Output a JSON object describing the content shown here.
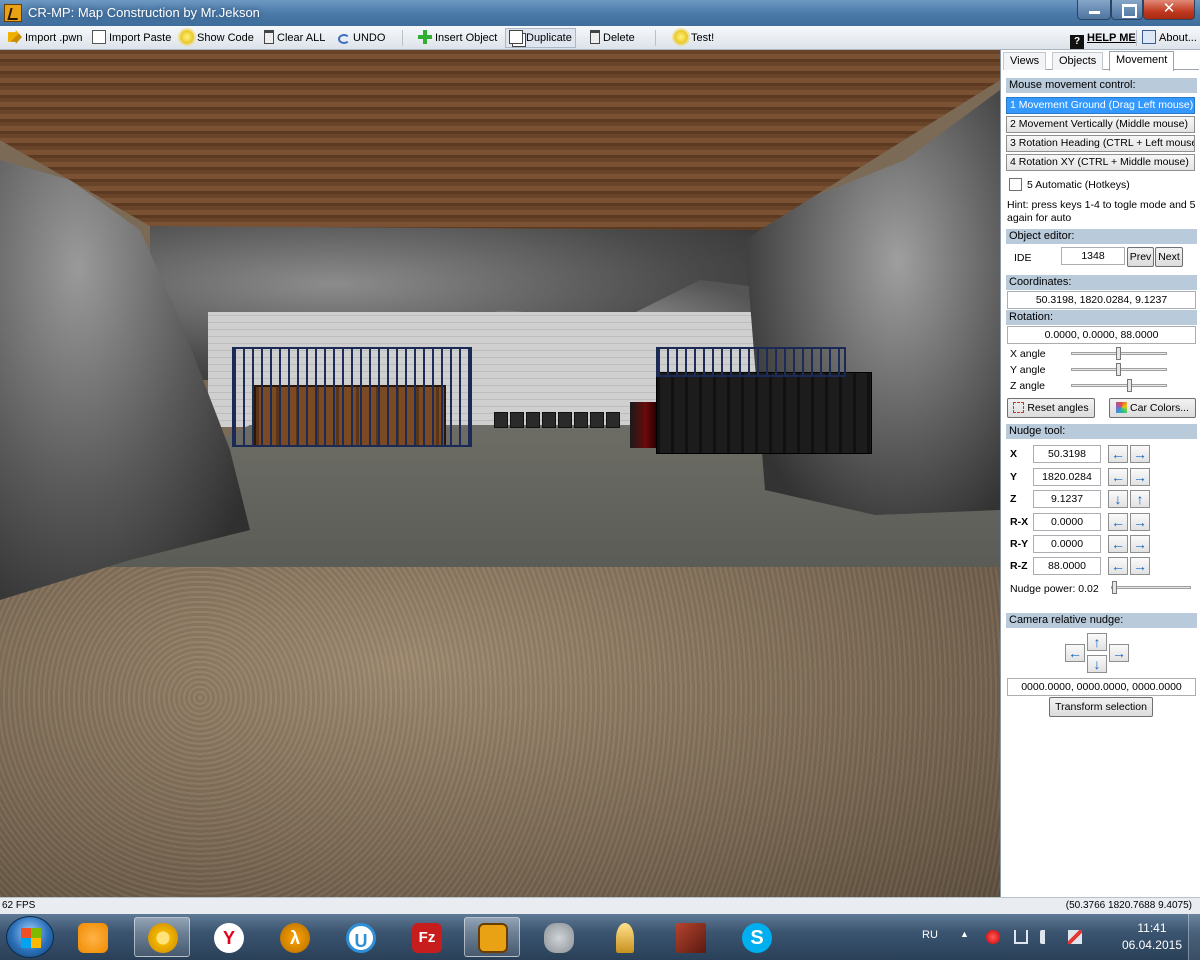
{
  "window": {
    "title": "CR-MP: Map Construction by Mr.Jekson",
    "close_glyph": "✕"
  },
  "toolbar": {
    "import_pwn": "Import .pwn",
    "import_paste": "Import Paste",
    "show_code": "Show Code",
    "clear_all": "Clear ALL",
    "undo": "UNDO",
    "insert_object": "Insert Object",
    "duplicate": "Duplicate",
    "delete": "Delete",
    "test": "Test!",
    "help_icon": "?",
    "help": "HELP ME",
    "about": "About..."
  },
  "panel": {
    "tabs": [
      "Views",
      "Objects",
      "Movement"
    ],
    "selected_tab": "Movement",
    "mouse_section": "Mouse movement control:",
    "modes": [
      "1 Movement Ground (Drag Left mouse)",
      "2 Movement Vertically (Middle mouse)",
      "3 Rotation Heading (CTRL + Left mouse)",
      "4 Rotation XY (CTRL + Middle mouse)"
    ],
    "selected_mode": 0,
    "automatic_label": "5 Automatic (Hotkeys)",
    "automatic_checked": false,
    "hint_line1": "Hint: press keys 1-4 to togle mode and 5",
    "hint_line2": "again for auto",
    "object_editor_section": "Object editor:",
    "ide_label": "IDE",
    "ide_value": "1348",
    "prev": "Prev",
    "next": "Next",
    "coordinates_section": "Coordinates:",
    "coordinates_value": "50.3198, 1820.0284, 9.1237",
    "rotation_section": "Rotation:",
    "rotation_value": "0.0000, 0.0000, 88.0000",
    "x_angle": "X angle",
    "y_angle": "Y angle",
    "z_angle": "Z angle",
    "x_angle_level": 0.5,
    "y_angle_level": 0.5,
    "z_angle_level": 0.62,
    "reset_angles": "Reset angles",
    "car_colors": "Car Colors...",
    "nudge_section": "Nudge tool:",
    "nudge": [
      {
        "label": "X",
        "value": "50.3198",
        "left": "←",
        "right": "→"
      },
      {
        "label": "Y",
        "value": "1820.0284",
        "left": "←",
        "right": "→"
      },
      {
        "label": "Z",
        "value": "9.1237",
        "left": "↓",
        "right": "↑"
      },
      {
        "label": "R-X",
        "value": "0.0000",
        "left": "←",
        "right": "→"
      },
      {
        "label": "R-Y",
        "value": "0.0000",
        "left": "←",
        "right": "→"
      },
      {
        "label": "R-Z",
        "value": "88.0000",
        "left": "←",
        "right": "→"
      }
    ],
    "nudge_power_label": "Nudge power: 0.02",
    "nudge_power_level": 0.02,
    "camera_section": "Camera relative nudge:",
    "camera_arrows": {
      "up": "↑",
      "down": "↓",
      "left": "←",
      "right": "→"
    },
    "camera_value": "0000.0000, 0000.0000, 0000.0000",
    "transform_selection": "Transform selection"
  },
  "status": {
    "fps": "62 FPS",
    "position": "(50.3766 1820.7688 9.4075)"
  },
  "taskbar": {
    "apps": [
      {
        "name": "avast-icon",
        "color": "#f08a00"
      },
      {
        "name": "chrome-canary-icon",
        "color": "#f2b600"
      },
      {
        "name": "yandex-browser-icon",
        "color": "#ffffff"
      },
      {
        "name": "half-life-icon",
        "color": "#d98200"
      },
      {
        "name": "uplay-icon",
        "color": "#2f8fd6"
      },
      {
        "name": "filezilla-icon",
        "color": "#c81d1d"
      },
      {
        "name": "map-construction-icon",
        "color": "#e9a214"
      },
      {
        "name": "evernote-elephant-icon",
        "color": "#9aa0a6"
      },
      {
        "name": "chess-icon",
        "color": "#e0b040"
      },
      {
        "name": "game-icon",
        "color": "#8b2f1f"
      },
      {
        "name": "skype-icon",
        "color": "#00aff0"
      }
    ],
    "skype_letter": "S",
    "filezilla_letter": "Fz",
    "uplay_letter": "U",
    "yandex_letter": "Y",
    "halflife_letter": "λ",
    "lang": "RU",
    "tray_up": "▲",
    "time": "11:41",
    "date": "06.04.2015"
  },
  "colors": {
    "panel_section": "#b9cadb",
    "selected_mode": "#3399ff",
    "arrow": "#1565c0"
  }
}
